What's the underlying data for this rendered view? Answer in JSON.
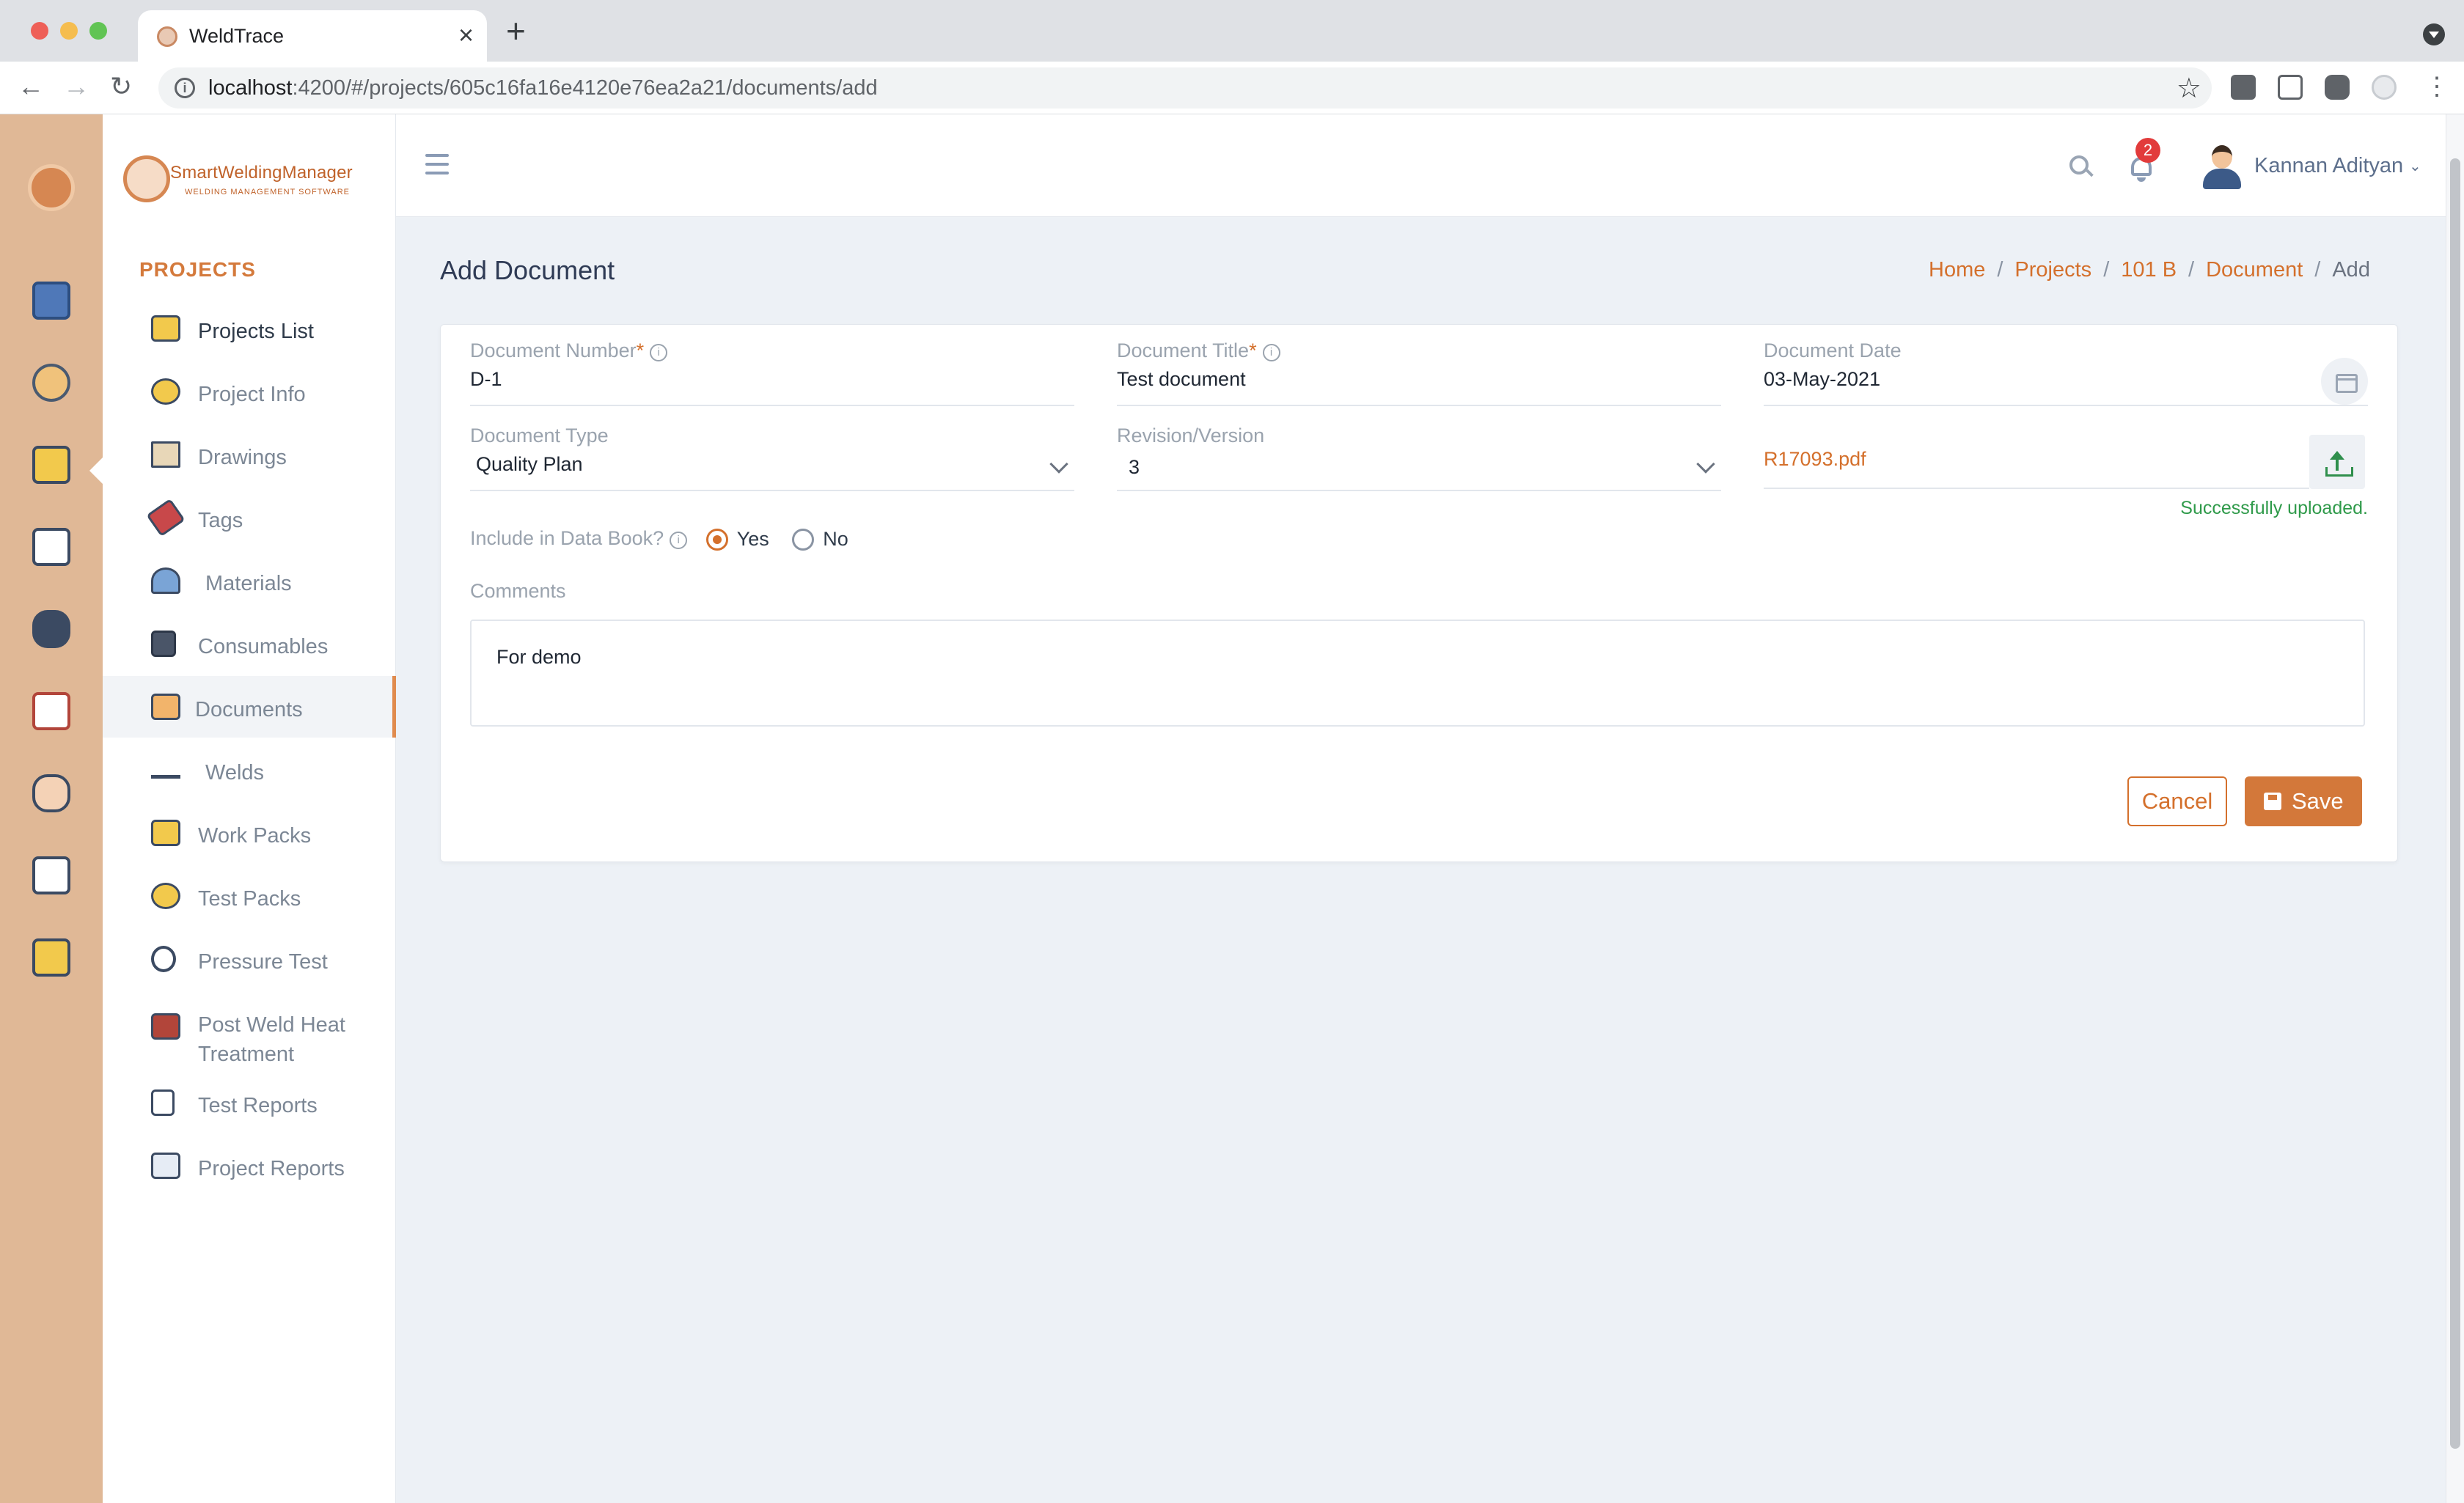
{
  "browser": {
    "tab_title": "WeldTrace",
    "url_host": "localhost",
    "url_path": ":4200/#/projects/605c16fa16e4120e76ea2a21/documents/add",
    "new_tab_glyph": "+",
    "close_glyph": "×"
  },
  "brand": {
    "name": "SmartWeldingManager",
    "tagline": "WELDING MANAGEMENT SOFTWARE",
    "accent_color": "#d4702c",
    "rail_color": "#e0b896"
  },
  "rail_icons": [
    "monitor-icon",
    "org-chart-icon",
    "projects-folder-icon",
    "checklist-gear-icon",
    "welder-icon",
    "whiteboard-icon",
    "team-icon",
    "report-clock-icon",
    "certificate-icon"
  ],
  "sidebar": {
    "section": "PROJECTS",
    "items": [
      {
        "label": "Projects List",
        "icon": "camera-folder-icon"
      },
      {
        "label": "Project Info",
        "icon": "gears-icon"
      },
      {
        "label": "Drawings",
        "icon": "drawing-tools-icon"
      },
      {
        "label": "Tags",
        "icon": "tag-icon"
      },
      {
        "label": "Materials",
        "icon": "pipes-icon"
      },
      {
        "label": "Consumables",
        "icon": "spool-icon"
      },
      {
        "label": "Documents",
        "icon": "folder-icon",
        "active": true
      },
      {
        "label": "Welds",
        "icon": "weld-spark-icon"
      },
      {
        "label": "Work Packs",
        "icon": "work-pack-icon"
      },
      {
        "label": "Test Packs",
        "icon": "radiation-icon"
      },
      {
        "label": "Pressure Test",
        "icon": "pressure-gauge-icon"
      },
      {
        "label": "Post Weld Heat Treatment",
        "icon": "heater-icon"
      },
      {
        "label": "Test Reports",
        "icon": "clipboard-icon"
      },
      {
        "label": "Project Reports",
        "icon": "report-chart-icon"
      }
    ]
  },
  "header": {
    "notifications_count": "2",
    "user_name": "Kannan Adityan"
  },
  "page": {
    "title": "Add Document",
    "breadcrumb": [
      "Home",
      "Projects",
      "101 B",
      "Document",
      "Add"
    ],
    "breadcrumb_sep": "/"
  },
  "form": {
    "document_number": {
      "label": "Document Number",
      "required": "*",
      "value": "D-1"
    },
    "document_title": {
      "label": "Document Title",
      "required": "*",
      "value": "Test document"
    },
    "document_date": {
      "label": "Document Date",
      "value": "03-May-2021"
    },
    "document_type": {
      "label": "Document Type",
      "value": "Quality Plan"
    },
    "revision": {
      "label": "Revision/Version",
      "value": "3"
    },
    "file": {
      "name": "R17093.pdf",
      "status": "Successfully uploaded."
    },
    "data_book": {
      "label": "Include in Data Book?",
      "yes": "Yes",
      "no": "No",
      "selected": "Yes"
    },
    "comments": {
      "label": "Comments",
      "value": "For demo"
    },
    "cancel_label": "Cancel",
    "save_label": "Save"
  }
}
